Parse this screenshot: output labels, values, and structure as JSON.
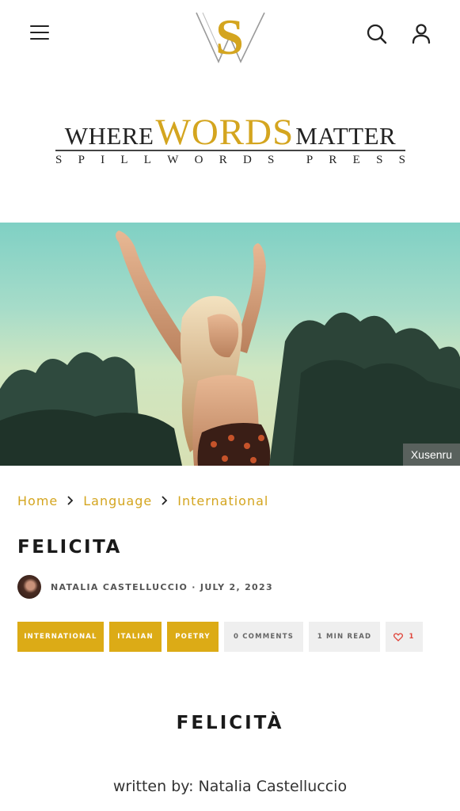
{
  "header": {
    "logo_monogram": "SW",
    "tagline": {
      "part1": "WHERE",
      "part2": "WORDS",
      "part3": "MATTER",
      "subtitle_letters": [
        "S",
        "P",
        "I",
        "L",
        "L",
        "W",
        "O",
        "R",
        "D",
        "S",
        " ",
        "P",
        "R",
        "E",
        "S",
        "S"
      ]
    },
    "brand_gold": "#d4a51f"
  },
  "hero": {
    "photo_credit": "Xusenru"
  },
  "breadcrumb": {
    "items": [
      "Home",
      "Language",
      "International"
    ]
  },
  "post": {
    "title": "FELICITA",
    "author": "NATALIA CASTELLUCCIO",
    "separator": "·",
    "date": "JULY 2, 2023",
    "tags": [
      "INTERNATIONAL",
      "ITALIAN",
      "POETRY"
    ],
    "comments": "0 COMMENTS",
    "read_time": "1 MIN READ",
    "likes": "1"
  },
  "content": {
    "poem_title": "FELICITÀ",
    "byline": "written by: Natalia Castelluccio"
  },
  "colors": {
    "accent": "#dcab16",
    "chip_grey": "#efefef",
    "like_red": "#e0443a"
  }
}
